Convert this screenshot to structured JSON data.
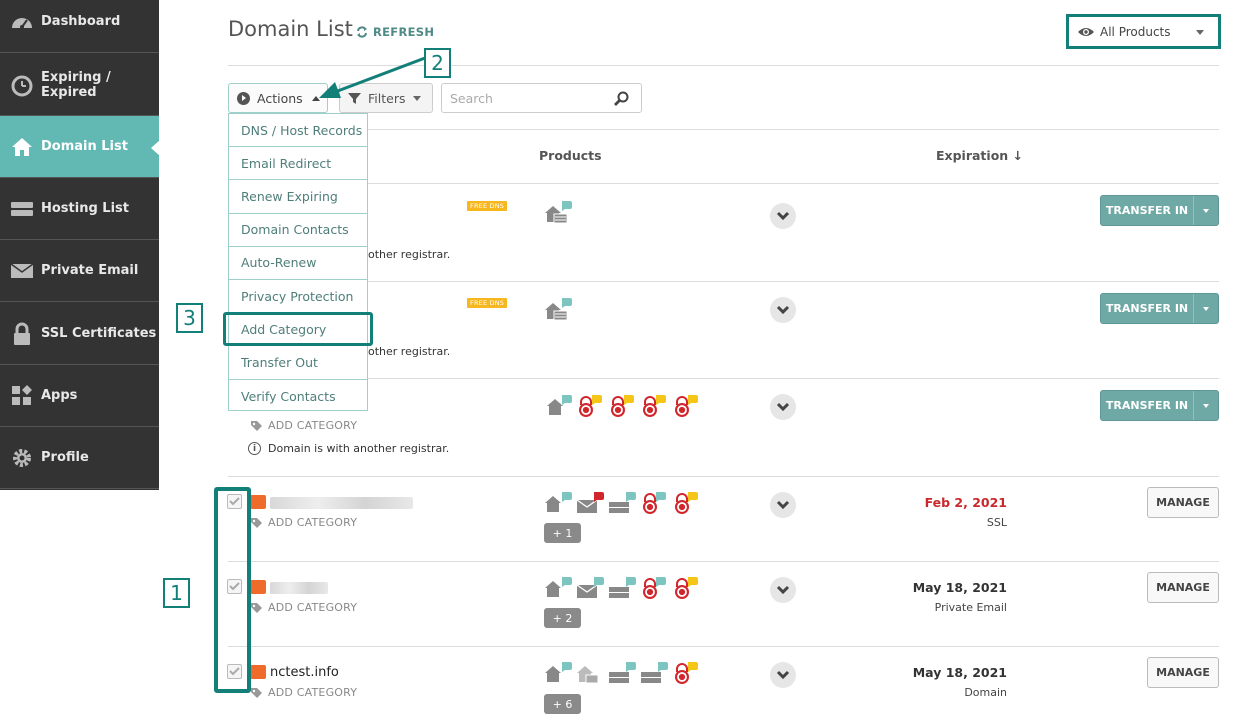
{
  "sidebar": {
    "items": [
      {
        "label": "Dashboard",
        "icon": "dashboard-gauge-icon",
        "active": false
      },
      {
        "label": "Expiring / Expired",
        "icon": "stopwatch-icon",
        "active": false
      },
      {
        "label": "Domain List",
        "icon": "home-icon",
        "active": true
      },
      {
        "label": "Hosting List",
        "icon": "server-icon",
        "active": false
      },
      {
        "label": "Private Email",
        "icon": "envelope-icon",
        "active": false
      },
      {
        "label": "SSL Certificates",
        "icon": "lock-icon",
        "active": false
      },
      {
        "label": "Apps",
        "icon": "apps-grid-icon",
        "active": false
      },
      {
        "label": "Profile",
        "icon": "gear-icon",
        "active": false
      }
    ]
  },
  "header": {
    "title": "Domain List",
    "refresh_label": "REFRESH",
    "product_filter": "All Products"
  },
  "toolbar": {
    "actions_label": "Actions",
    "filters_label": "Filters",
    "search_placeholder": "Search"
  },
  "columns": {
    "products": "Products",
    "expiration": "Expiration ↓"
  },
  "actions_menu": [
    "DNS / Host Records",
    "Email Redirect",
    "Renew Expiring",
    "Domain Contacts",
    "Auto-Renew",
    "Privacy Protection",
    "Add Category",
    "Transfer Out",
    "Verify Contacts"
  ],
  "callouts": {
    "one": "1",
    "two": "2",
    "three": "3"
  },
  "rows": [
    {
      "free_dns": "FREE DNS",
      "registrar_note": "other registrar.",
      "button": "TRANSFER IN"
    },
    {
      "free_dns": "FREE DNS",
      "registrar_note": "other registrar.",
      "button": "TRANSFER IN"
    },
    {
      "add_category": "ADD CATEGORY",
      "registrar_note": "Domain is with another registrar.",
      "button": "TRANSFER IN"
    },
    {
      "add_category": "ADD CATEGORY",
      "expiration_date": "Feb 2, 2021",
      "expiration_type": "SSL",
      "more": "+ 1",
      "button": "MANAGE"
    },
    {
      "add_category": "ADD CATEGORY",
      "expiration_date": "May 18, 2021",
      "expiration_type": "Private Email",
      "more": "+ 2",
      "button": "MANAGE"
    },
    {
      "domain": "nctest.info",
      "add_category": "ADD CATEGORY",
      "expiration_date": "May 18, 2021",
      "expiration_type": "Domain",
      "more": "+ 6",
      "button": "MANAGE"
    }
  ],
  "colors": {
    "sidebar_bg": "#333333",
    "active_item": "#62b8b3",
    "annotation": "#137f79",
    "transfer_button": "#6fa9a6",
    "ssl_red": "#d0262c",
    "expiry_red": "#c9282d",
    "namecheap_orange": "#ee6b2a"
  }
}
